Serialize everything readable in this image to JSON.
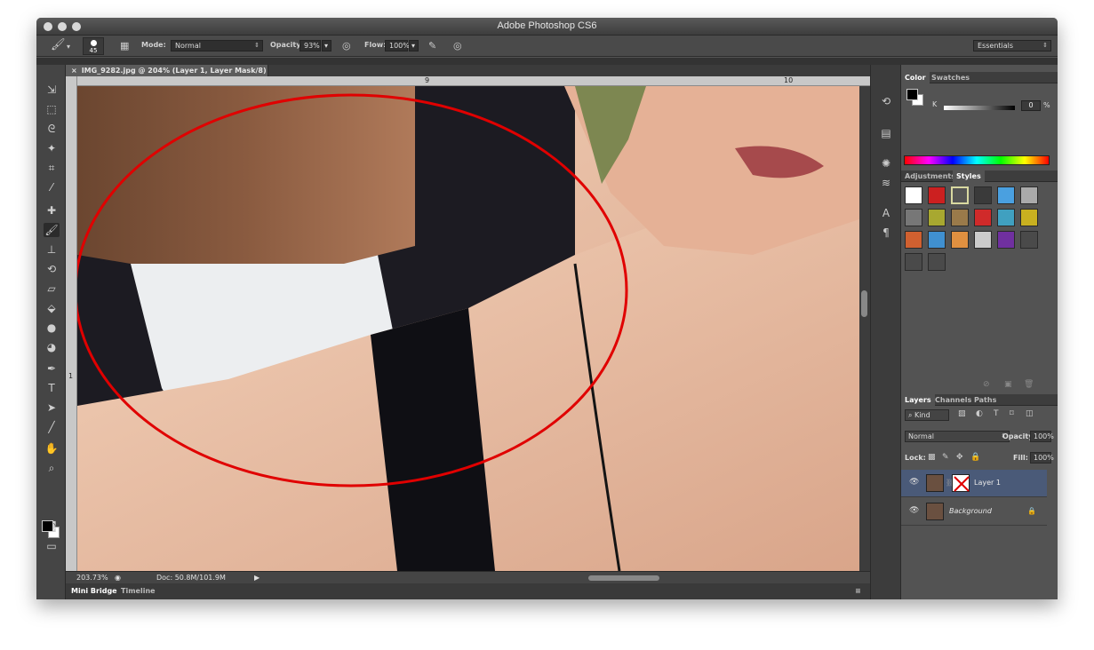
{
  "app": {
    "title": "Adobe Photoshop CS6"
  },
  "options": {
    "brush_size": "45",
    "mode_label": "Mode:",
    "mode_value": "Normal",
    "opacity_label": "Opacity:",
    "opacity_value": "93%",
    "flow_label": "Flow:",
    "flow_value": "100%",
    "workspace": "Essentials"
  },
  "document": {
    "tab_label": "IMG_9282.jpg @ 204% (Layer 1, Layer Mask/8) *",
    "ruler_marks": [
      "9",
      "10"
    ],
    "ruler_v_mark": "1"
  },
  "status": {
    "zoom": "203.73%",
    "doc_size": "Doc: 50.8M/101.9M"
  },
  "bottom_tabs": [
    "Mini Bridge",
    "Timeline"
  ],
  "color_panel": {
    "tabs": [
      "Color",
      "Swatches"
    ],
    "channel_label": "K",
    "value": "0",
    "unit": "%"
  },
  "adj_panel": {
    "tabs": [
      "Adjustments",
      "Styles"
    ]
  },
  "layers_panel": {
    "tabs": [
      "Layers",
      "Channels",
      "Paths"
    ],
    "kind_filter": "Kind",
    "blend_mode": "Normal",
    "opacity_label": "Opacity:",
    "opacity_value": "100%",
    "lock_label": "Lock:",
    "fill_label": "Fill:",
    "fill_value": "100%",
    "layers": [
      {
        "name": "Layer 1",
        "selected": true
      },
      {
        "name": "Background",
        "selected": false,
        "locked": true
      }
    ]
  },
  "colors": {
    "annotation_ellipse": "#e00000",
    "selected_layer": "#4a5a78"
  }
}
